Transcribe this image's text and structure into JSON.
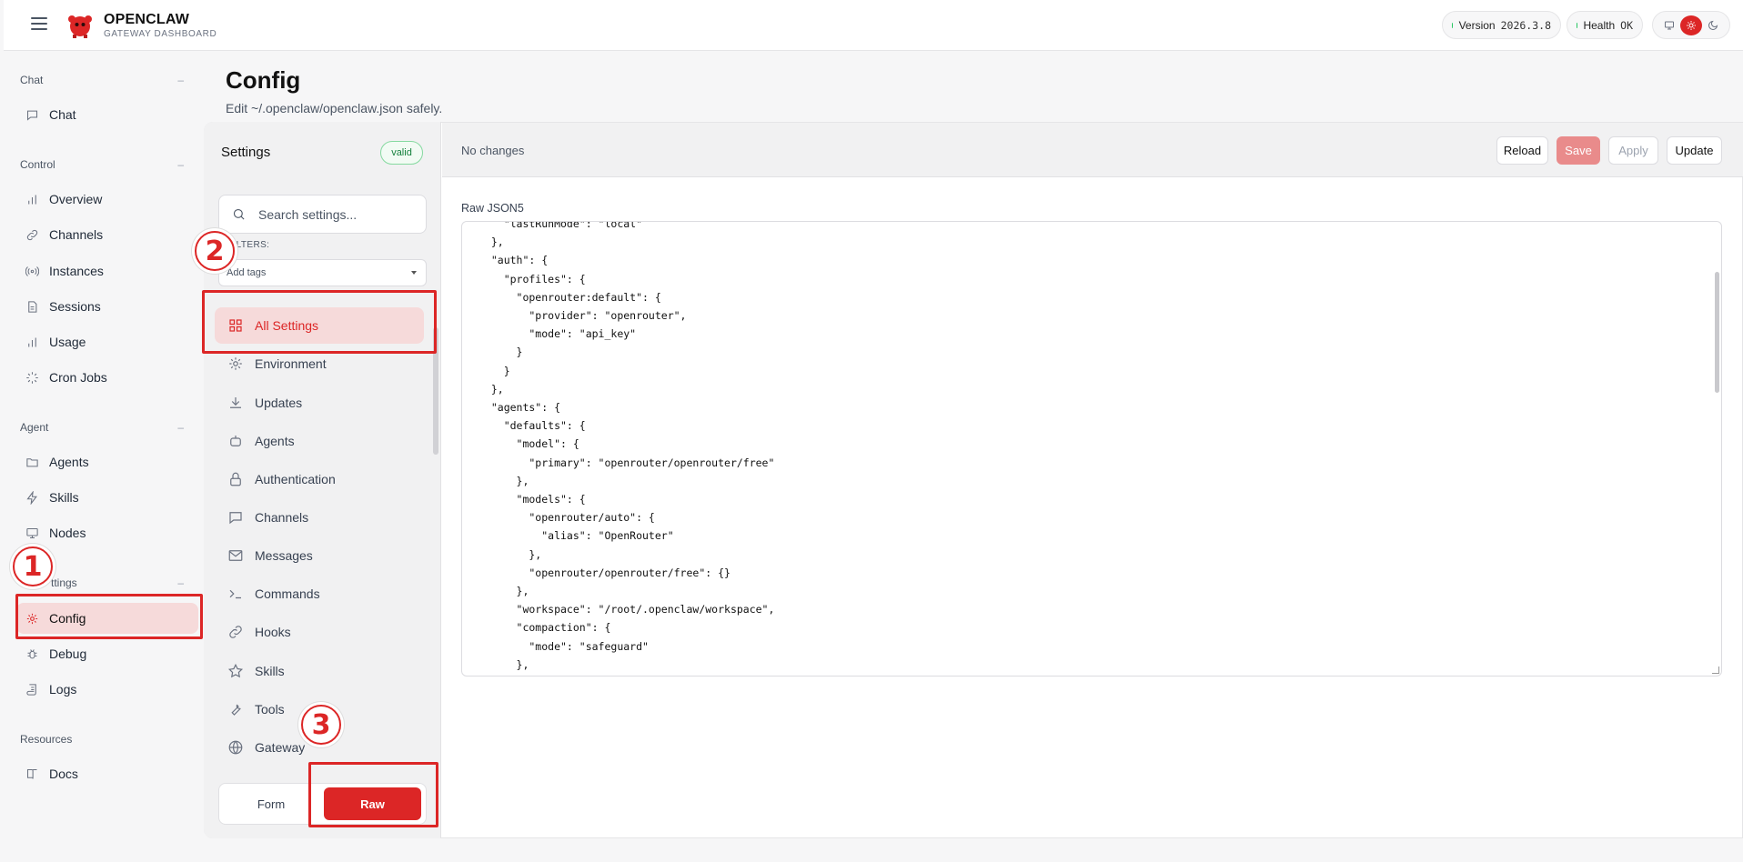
{
  "header": {
    "brand_name": "OPENCLAW",
    "brand_sub": "GATEWAY DASHBOARD",
    "version_label": "Version",
    "version_value": "2026.3.8",
    "health_label": "Health",
    "health_value": "OK"
  },
  "sidebar": {
    "groups": [
      {
        "title": "Chat",
        "items": [
          "Chat"
        ]
      },
      {
        "title": "Control",
        "items": [
          "Overview",
          "Channels",
          "Instances",
          "Sessions",
          "Usage",
          "Cron Jobs"
        ]
      },
      {
        "title": "Agent",
        "items": [
          "Agents",
          "Skills",
          "Nodes"
        ]
      },
      {
        "title": "ttings",
        "items": [
          "Config",
          "Debug",
          "Logs"
        ]
      },
      {
        "title": "Resources",
        "items": [
          "Docs"
        ]
      }
    ],
    "collapse_glyph": "–"
  },
  "page": {
    "title": "Config",
    "subtitle": "Edit ~/.openclaw/openclaw.json safely."
  },
  "settings": {
    "heading": "Settings",
    "status_badge": "valid",
    "search_placeholder": "Search settings...",
    "filters_label": "FILTERS:",
    "tags_placeholder": "Add tags",
    "categories": [
      "All Settings",
      "Environment",
      "Updates",
      "Agents",
      "Authentication",
      "Channels",
      "Messages",
      "Commands",
      "Hooks",
      "Skills",
      "Tools",
      "Gateway"
    ],
    "mode_form": "Form",
    "mode_raw": "Raw"
  },
  "editor": {
    "status": "No changes",
    "reload_label": "Reload",
    "save_label": "Save",
    "apply_label": "Apply",
    "update_label": "Update",
    "raw_label": "Raw JSON5",
    "code": "    \"lastRunMode\": \"local\"\n  },\n  \"auth\": {\n    \"profiles\": {\n      \"openrouter:default\": {\n        \"provider\": \"openrouter\",\n        \"mode\": \"api_key\"\n      }\n    }\n  },\n  \"agents\": {\n    \"defaults\": {\n      \"model\": {\n        \"primary\": \"openrouter/openrouter/free\"\n      },\n      \"models\": {\n        \"openrouter/auto\": {\n          \"alias\": \"OpenRouter\"\n        },\n        \"openrouter/openrouter/free\": {}\n      },\n      \"workspace\": \"/root/.openclaw/workspace\",\n      \"compaction\": {\n        \"mode\": \"safeguard\"\n      },"
  },
  "annotations": {
    "step1": "1",
    "step2": "2",
    "step3": "3"
  },
  "colors": {
    "accent": "#dc2626",
    "status_ok": "#22c55e"
  }
}
